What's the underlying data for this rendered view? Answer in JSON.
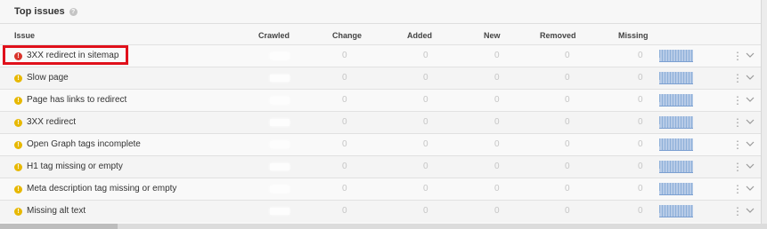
{
  "panel": {
    "title": "Top issues",
    "help_icon": "question-icon"
  },
  "columns": {
    "issue": "Issue",
    "crawled": "Crawled",
    "change": "Change",
    "added": "Added",
    "new": "New",
    "removed": "Removed",
    "missing": "Missing"
  },
  "rows": [
    {
      "label": "3XX redirect in sitemap",
      "severity": "error",
      "change": "0",
      "added": "0",
      "new": "0",
      "removed": "0",
      "missing": "0"
    },
    {
      "label": "Slow page",
      "severity": "warning",
      "change": "0",
      "added": "0",
      "new": "0",
      "removed": "0",
      "missing": "0"
    },
    {
      "label": "Page has links to redirect",
      "severity": "warning",
      "change": "0",
      "added": "0",
      "new": "0",
      "removed": "0",
      "missing": "0"
    },
    {
      "label": "3XX redirect",
      "severity": "warning",
      "change": "0",
      "added": "0",
      "new": "0",
      "removed": "0",
      "missing": "0"
    },
    {
      "label": "Open Graph tags incomplete",
      "severity": "warning",
      "change": "0",
      "added": "0",
      "new": "0",
      "removed": "0",
      "missing": "0"
    },
    {
      "label": "H1 tag missing or empty",
      "severity": "warning",
      "change": "0",
      "added": "0",
      "new": "0",
      "removed": "0",
      "missing": "0"
    },
    {
      "label": "Meta description tag missing or empty",
      "severity": "warning",
      "change": "0",
      "added": "0",
      "new": "0",
      "removed": "0",
      "missing": "0"
    },
    {
      "label": "Missing alt text",
      "severity": "warning",
      "change": "0",
      "added": "0",
      "new": "0",
      "removed": "0",
      "missing": "0"
    }
  ],
  "colors": {
    "error": "#d9342b",
    "warning": "#e7b800",
    "highlight": "#e0101b",
    "sparkline": "#8fb0d9"
  }
}
